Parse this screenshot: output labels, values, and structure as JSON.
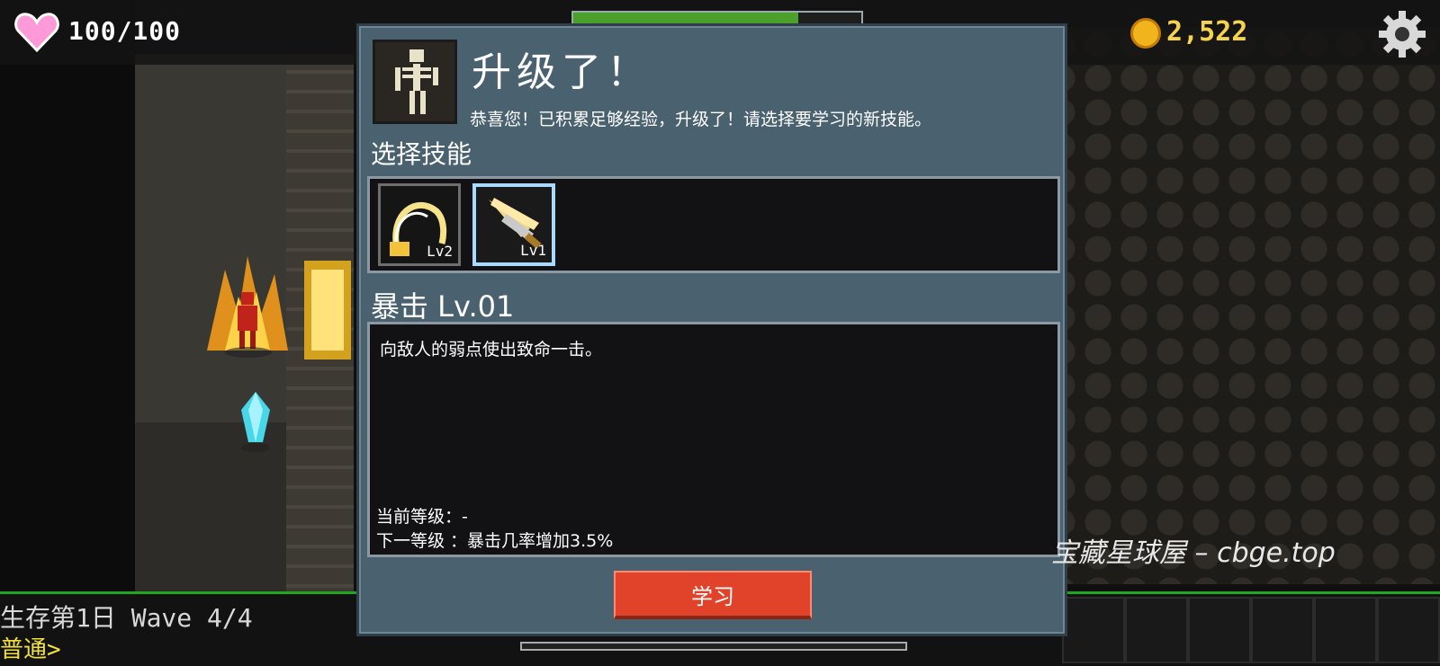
{
  "hud": {
    "hp": "100/100",
    "gold": "2,522",
    "heart_icon": "heart-icon",
    "coin_icon": "coin-icon",
    "settings_icon": "gear-icon",
    "top_bar_progress": 0.78
  },
  "status": {
    "day_wave": "生存第1日 Wave 4/4",
    "mode": "普通>"
  },
  "dialog": {
    "title": "升级了！",
    "description": "恭喜您！已积累足够经验，升级了！请选择要学习的新技能。",
    "section_label": "选择技能",
    "skills": [
      {
        "icon": "slash-arc-icon",
        "level": "Lv2",
        "selected": false
      },
      {
        "icon": "sword-strike-icon",
        "level": "Lv1",
        "selected": true
      }
    ],
    "selected_skill_name": "暴击 Lv.01",
    "selected_skill_desc": "向敌人的弱点使出致命一击。",
    "current_level": "当前等级：-",
    "next_level": "下一等级 ：暴击几率增加3.5%",
    "learn_button": "学习"
  },
  "watermark": "宝藏星球屋 – cbge.top",
  "colors": {
    "dialog_bg": "#4a6170",
    "button_red": "#e0432a",
    "gold_text": "#f6d34c",
    "hp_green": "#1ea81e"
  }
}
